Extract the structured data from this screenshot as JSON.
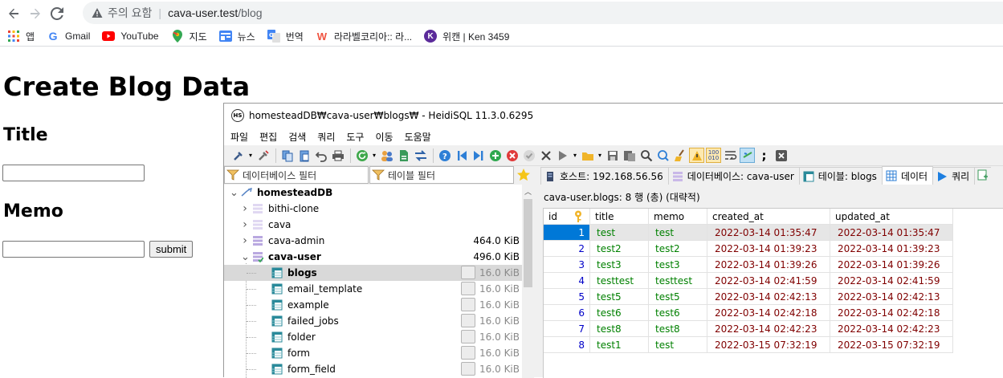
{
  "browser": {
    "warning": "주의 요함",
    "host": "cava-user.test",
    "path": "/blog",
    "bookmarks": [
      {
        "label": "앱",
        "icon": "apps-grid-icon"
      },
      {
        "label": "Gmail",
        "icon": "google-icon"
      },
      {
        "label": "YouTube",
        "icon": "youtube-icon"
      },
      {
        "label": "지도",
        "icon": "maps-pin-icon"
      },
      {
        "label": "뉴스",
        "icon": "news-icon"
      },
      {
        "label": "번역",
        "icon": "translate-icon"
      },
      {
        "label": "라라벨코리아:: 라...",
        "icon": "laravel-icon"
      },
      {
        "label": "위캔 | Ken 3459",
        "icon": "k-icon"
      }
    ]
  },
  "page": {
    "heading": "Create Blog Data",
    "title_label": "Title",
    "memo_label": "Memo",
    "submit_label": "submit",
    "title_value": "",
    "memo_value": ""
  },
  "heidi": {
    "window_title": "homesteadDB₩cava-user₩blogs₩ - HeidiSQL 11.3.0.6295",
    "menu": [
      "파일",
      "편집",
      "검색",
      "쿼리",
      "도구",
      "이동",
      "도움말"
    ],
    "db_filter_placeholder": "데이터베이스 필터",
    "table_filter_placeholder": "테이블 필터",
    "tree": [
      {
        "name": "homesteadDB",
        "size": "",
        "level": 0,
        "expanded": true,
        "bold": true,
        "kind": "server"
      },
      {
        "name": "bithi-clone",
        "size": "",
        "level": 1,
        "expanded": false,
        "kind": "db"
      },
      {
        "name": "cava",
        "size": "",
        "level": 1,
        "expanded": false,
        "kind": "db"
      },
      {
        "name": "cava-admin",
        "size": "464.0 KiB",
        "level": 1,
        "expanded": false,
        "kind": "db"
      },
      {
        "name": "cava-user",
        "size": "496.0 KiB",
        "level": 1,
        "expanded": true,
        "bold": true,
        "kind": "db"
      },
      {
        "name": "blogs",
        "size": "16.0 KiB",
        "level": 2,
        "selected": true,
        "bold": true,
        "kind": "table"
      },
      {
        "name": "email_template",
        "size": "16.0 KiB",
        "level": 2,
        "kind": "table"
      },
      {
        "name": "example",
        "size": "16.0 KiB",
        "level": 2,
        "kind": "table"
      },
      {
        "name": "failed_jobs",
        "size": "16.0 KiB",
        "level": 2,
        "kind": "table"
      },
      {
        "name": "folder",
        "size": "16.0 KiB",
        "level": 2,
        "kind": "table"
      },
      {
        "name": "form",
        "size": "16.0 KiB",
        "level": 2,
        "kind": "table"
      },
      {
        "name": "form_field",
        "size": "16.0 KiB",
        "level": 2,
        "kind": "table"
      }
    ],
    "tabs": [
      {
        "label": "호스트: 192.168.56.56",
        "icon": "host-icon"
      },
      {
        "label": "데이터베이스: cava-user",
        "icon": "database-icon"
      },
      {
        "label": "테이블: blogs",
        "icon": "table-icon"
      },
      {
        "label": "데이터",
        "icon": "data-grid-icon",
        "active": true
      },
      {
        "label": "쿼리",
        "icon": "query-play-icon"
      }
    ],
    "grid_info": "cava-user.blogs: 8 행 (총) (대략적)",
    "columns": [
      "id",
      "title",
      "memo",
      "created_at",
      "updated_at"
    ],
    "rows": [
      {
        "id": "1",
        "title": "test",
        "memo": "test",
        "created_at": "2022-03-14 01:35:47",
        "updated_at": "2022-03-14 01:35:47"
      },
      {
        "id": "2",
        "title": "test2",
        "memo": "test2",
        "created_at": "2022-03-14 01:39:23",
        "updated_at": "2022-03-14 01:39:23"
      },
      {
        "id": "3",
        "title": "test3",
        "memo": "test3",
        "created_at": "2022-03-14 01:39:26",
        "updated_at": "2022-03-14 01:39:26"
      },
      {
        "id": "4",
        "title": "testtest",
        "memo": "testtest",
        "created_at": "2022-03-14 02:41:59",
        "updated_at": "2022-03-14 02:41:59"
      },
      {
        "id": "5",
        "title": "test5",
        "memo": "test5",
        "created_at": "2022-03-14 02:42:13",
        "updated_at": "2022-03-14 02:42:13"
      },
      {
        "id": "6",
        "title": "test6",
        "memo": "test6",
        "created_at": "2022-03-14 02:42:18",
        "updated_at": "2022-03-14 02:42:18"
      },
      {
        "id": "7",
        "title": "test8",
        "memo": "test8",
        "created_at": "2022-03-14 02:42:23",
        "updated_at": "2022-03-14 02:42:23"
      },
      {
        "id": "8",
        "title": "test1",
        "memo": "test",
        "created_at": "2022-03-15 07:32:19",
        "updated_at": "2022-03-15 07:32:19"
      }
    ]
  }
}
